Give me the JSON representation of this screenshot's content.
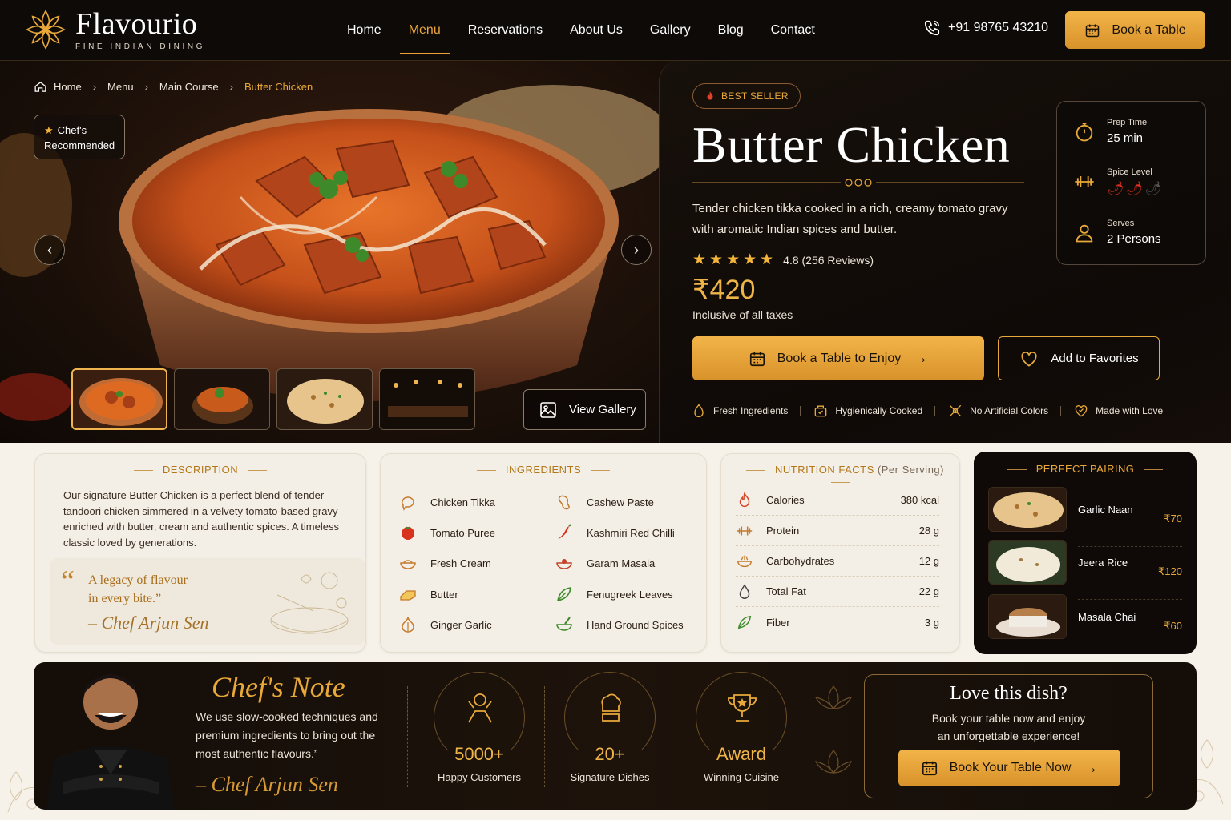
{
  "brand": {
    "name": "Flavourio",
    "tagline": "FINE INDIAN DINING"
  },
  "nav": {
    "items": [
      "Home",
      "Menu",
      "Reservations",
      "About Us",
      "Gallery",
      "Blog",
      "Contact"
    ],
    "active": "Menu"
  },
  "header": {
    "phone": "+91 98765 43210",
    "book_label": "Book a Table"
  },
  "breadcrumb": [
    "Home",
    "Menu",
    "Main Course",
    "Butter Chicken"
  ],
  "hero": {
    "chef_recommended": "Chef's Recommended",
    "view_gallery": "View Gallery",
    "thumbnails": [
      "butter-chicken",
      "curry-bowl",
      "naan",
      "restaurant-interior"
    ],
    "badge": "BEST SELLER",
    "title": "Butter Chicken",
    "description": "Tender chicken tikka cooked in a rich, creamy tomato gravy with aromatic Indian spices and butter.",
    "rating": 4.8,
    "rating_text": "4.8 (256 Reviews)",
    "stars": 5,
    "price": "₹420",
    "price_note": "Inclusive of all taxes",
    "book_label": "Book a Table to Enjoy",
    "fav_label": "Add to Favorites",
    "features": [
      "Fresh Ingredients",
      "Hygienically Cooked",
      "No Artificial Colors",
      "Made with Love"
    ],
    "info": {
      "prep_label": "Prep Time",
      "prep_value": "25 min",
      "spice_label": "Spice Level",
      "spice_level": 2,
      "spice_max": 3,
      "serves_label": "Serves",
      "serves_value": "2 Persons"
    }
  },
  "description": {
    "heading": "DESCRIPTION",
    "text": "Our signature Butter Chicken is a perfect blend of tender tandoori chicken simmered in a velvety tomato-based gravy enriched with butter, cream and authentic spices. A timeless classic loved by generations.",
    "quote_l1": "A legacy of flavour",
    "quote_l2": "in every bite.”",
    "signature": "– Chef Arjun Sen"
  },
  "ingredients": {
    "heading": "INGREDIENTS",
    "left": [
      "Chicken Tikka",
      "Tomato Puree",
      "Fresh Cream",
      "Butter",
      "Ginger Garlic"
    ],
    "right": [
      "Cashew Paste",
      "Kashmiri Red Chilli",
      "Garam Masala",
      "Fenugreek Leaves",
      "Hand Ground Spices"
    ]
  },
  "nutrition": {
    "heading": "NUTRITION FACTS",
    "subheading": "(Per Serving)",
    "rows": [
      {
        "label": "Calories",
        "value": "380 kcal"
      },
      {
        "label": "Protein",
        "value": "28 g"
      },
      {
        "label": "Carbohydrates",
        "value": "12 g"
      },
      {
        "label": "Total Fat",
        "value": "22 g"
      },
      {
        "label": "Fiber",
        "value": "3 g"
      }
    ]
  },
  "pairing": {
    "heading": "PERFECT PAIRING",
    "items": [
      {
        "name": "Garlic Naan",
        "price": "₹70"
      },
      {
        "name": "Jeera Rice",
        "price": "₹120"
      },
      {
        "name": "Masala Chai",
        "price": "₹60"
      }
    ]
  },
  "chef_note": {
    "title": "Chef's Note",
    "text": "We use slow-cooked techniques and premium ingredients to bring out the most authentic flavours.”",
    "signature": "– Chef Arjun Sen"
  },
  "stats": [
    {
      "value": "5000+",
      "label": "Happy Customers"
    },
    {
      "value": "20+",
      "label": "Signature Dishes"
    },
    {
      "value": "Award",
      "label": "Winning Cuisine"
    }
  ],
  "cta": {
    "title": "Love this dish?",
    "line1": "Book your table now and enjoy",
    "line2": "an unforgettable experience!",
    "button": "Book Your Table Now"
  },
  "colors": {
    "accent": "#e9a93a",
    "dark": "#0d0a08",
    "cream": "#f3eee6"
  }
}
